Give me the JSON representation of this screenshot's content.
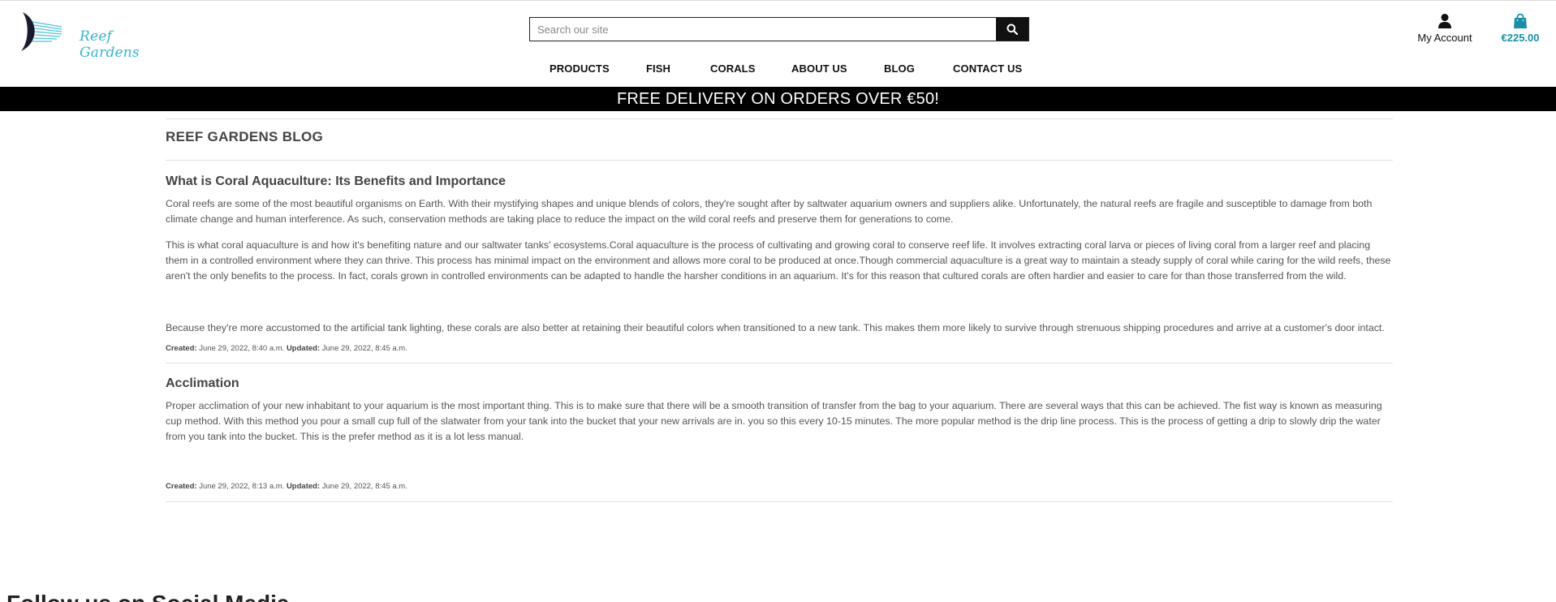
{
  "header": {
    "logo_text": "Reef Gardens",
    "search": {
      "placeholder": "Search our site"
    },
    "account_label": "My Account",
    "cart_total": "€225.00"
  },
  "nav": {
    "items": [
      {
        "label": "PRODUCTS"
      },
      {
        "label": "FISH"
      },
      {
        "label": "CORALS"
      },
      {
        "label": "ABOUT US"
      },
      {
        "label": "BLOG"
      },
      {
        "label": "CONTACT US"
      }
    ]
  },
  "banner": {
    "text": "FREE DELIVERY ON ORDERS OVER €50!"
  },
  "blog": {
    "title": "REEF GARDENS BLOG",
    "posts": [
      {
        "title": "What is Coral Aquaculture: Its Benefits and Importance",
        "paragraphs": [
          "Coral reefs are some of the most beautiful organisms on Earth. With their mystifying shapes and unique blends of colors, they're sought after by saltwater aquarium owners and suppliers alike. Unfortunately, the natural reefs are fragile and susceptible to damage from both climate change and human interference. As such, conservation methods are taking place to reduce the impact on the wild coral reefs and preserve them for generations to come.",
          "This is what coral aquaculture is and how it's benefiting nature and our saltwater tanks' ecosystems.Coral aquaculture is the process of cultivating and growing coral to conserve reef life. It involves extracting coral larva or pieces of living coral from a larger reef and placing them in a controlled environment where they can thrive. This process has minimal impact on the environment and allows more coral to be produced at once.Though commercial aquaculture is a great way to maintain a steady supply of coral while caring for the wild reefs, these aren't the only benefits to the process. In fact, corals grown in controlled environments can be adapted to handle the harsher conditions in an aquarium. It's for this reason that cultured corals are often hardier and easier to care for than those transferred from the wild.",
          "Because they're more accustomed to the artificial tank lighting, these corals are also better at retaining their beautiful colors when transitioned to a new tank. This makes them more likely to survive through strenuous shipping procedures and arrive at a customer's door intact."
        ],
        "created_label": "Created:",
        "created": "June 29, 2022, 8:40 a.m.",
        "updated_label": "Updated:",
        "updated": "June 29, 2022, 8:45 a.m."
      },
      {
        "title": "Acclimation",
        "paragraphs": [
          "Proper acclimation of your new inhabitant to your aquarium is the most important thing. This is to make sure that there will be a smooth transition of transfer from the bag to your aquarium. There are several ways that this can be achieved. The fist way is known as measuring cup method. With this method you pour a small cup full of the slatwater from your tank into the bucket that your new arrivals are in. you so this every 10-15 minutes. The more popular method is the drip line process. This is the process of getting a drip to slowly drip the water from you tank into the bucket. This is the prefer method as it is a lot less manual."
        ],
        "created_label": "Created:",
        "created": "June 29, 2022, 8:13 a.m.",
        "updated_label": "Updated:",
        "updated": "June 29, 2022, 8:45 a.m."
      }
    ]
  },
  "footer": {
    "heading": "Follow us on Social Media"
  },
  "colors": {
    "accent": "#39b3cc",
    "cart": "#1b8fa8",
    "banner_bg": "#000000"
  },
  "icons": {
    "search": "search-icon",
    "account": "user-icon",
    "cart": "shopping-bag-icon",
    "logo": "fish-fin-logo"
  }
}
